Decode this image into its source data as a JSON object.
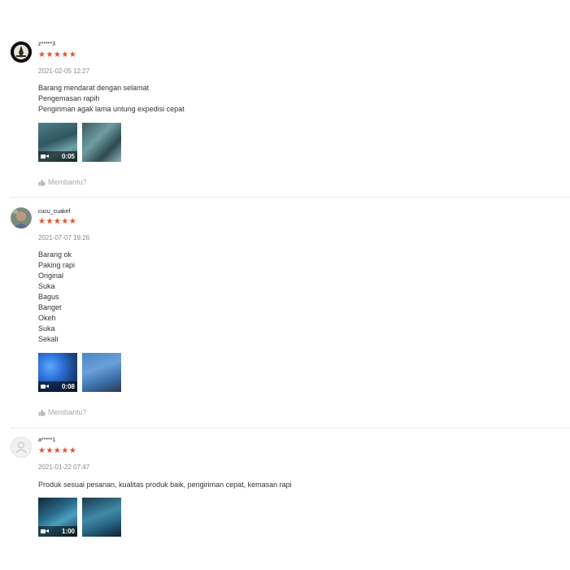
{
  "reviews": [
    {
      "username": "z*****3",
      "rating": 5,
      "stars": "★★★★★",
      "date": "2021-02-05 12:27",
      "lines": [
        "Barang mendarat dengan selamat",
        "Pengemasan rapih",
        "Pengiriman agak lama untung expedisi cepat"
      ],
      "video_duration": "0:05",
      "helpful_label": "Membantu?"
    },
    {
      "username": "cucu_cuakef",
      "rating": 5,
      "stars": "★★★★★",
      "date": "2021-07-07 19:26",
      "lines": [
        "Barang ok",
        "Paking rapi",
        "Original",
        "Suka",
        "Bagus",
        "Banget",
        "Okeh",
        "Suka",
        "Sekali"
      ],
      "video_duration": "0:08",
      "helpful_label": "Membantu?"
    },
    {
      "username": "a*****1",
      "rating": 5,
      "stars": "★★★★★",
      "date": "2021-01-22 07:47",
      "lines": [
        "Produk sesuai pesanan,  kualitas produk baik,  pengiriman cepat,  kemasan rapi"
      ],
      "video_duration": "1:00"
    }
  ],
  "colors": {
    "star": "#ee4d2d",
    "muted": "#8a8a8a",
    "divider": "#e8e8e8"
  },
  "icons": {
    "video": "video-camera-icon",
    "helpful": "thumbs-up-icon",
    "default_avatar": "user-silhouette-icon"
  }
}
